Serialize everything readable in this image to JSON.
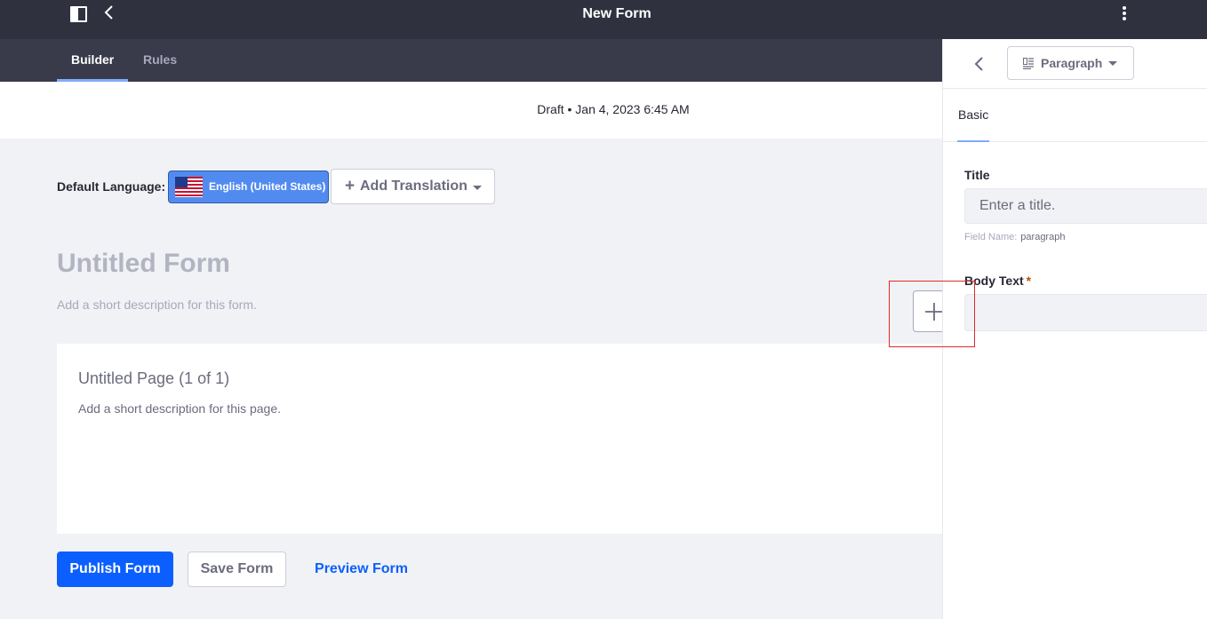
{
  "topbar": {
    "title": "New Form"
  },
  "tabs": [
    {
      "label": "Builder",
      "active": true
    },
    {
      "label": "Rules",
      "active": false
    }
  ],
  "status": {
    "text": "Draft • Jan 4, 2023 6:45 AM"
  },
  "language": {
    "label": "Default Language:",
    "selected": "English (United States)",
    "add_translation": "Add Translation"
  },
  "form": {
    "title_placeholder": "Untitled Form",
    "description_placeholder": "Add a short description for this form."
  },
  "page": {
    "title": "Untitled Page (1 of 1)",
    "description": "Add a short description for this page."
  },
  "actions": {
    "publish": "Publish Form",
    "save": "Save Form",
    "preview": "Preview Form"
  },
  "panel": {
    "field_type": "Paragraph",
    "tab": "Basic",
    "title_label": "Title",
    "title_placeholder": "Enter a title.",
    "field_name_label": "Field Name:",
    "field_name_value": "paragraph",
    "body_label": "Body Text",
    "body_required_mark": "*"
  },
  "colors": {
    "topbar": "#30313f",
    "tabsbar": "#393a4a",
    "primary": "#0b5fff",
    "language_button": "#528bf0",
    "highlight": "#e0292c"
  }
}
